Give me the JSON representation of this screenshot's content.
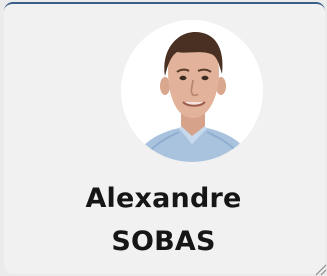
{
  "profile": {
    "first_name": "Alexandre",
    "last_name": "SOBAS",
    "avatar_icon": "profile-photo"
  },
  "colors": {
    "card_background": "#f1f1f1",
    "page_background": "#ebebeb",
    "accent": "#3c5f8a",
    "name_text": "#161616"
  }
}
